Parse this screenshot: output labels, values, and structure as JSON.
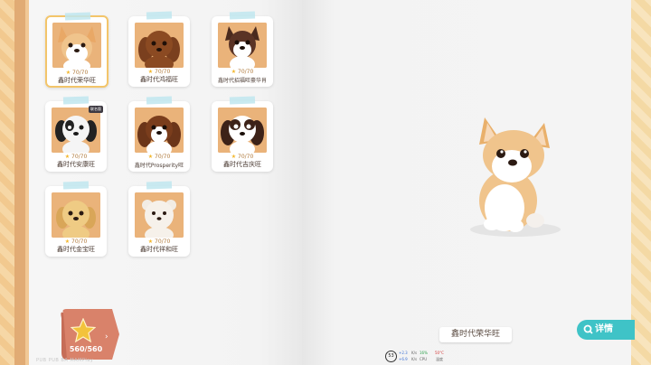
{
  "cards": [
    {
      "stars": "70/70",
      "name": "鑫时代荣华旺",
      "selected": true
    },
    {
      "stars": "70/70",
      "name": "鑫时代鸿福旺"
    },
    {
      "stars": "70/70",
      "name": "鑫时代招福旺豪华肖"
    },
    {
      "stars": "70/70",
      "name": "鑫时代安康旺",
      "badge": "联名版"
    },
    {
      "stars": "70/70",
      "name": "鑫时代Prosperity旺"
    },
    {
      "stars": "70/70",
      "name": "鑫时代吉庆旺"
    },
    {
      "stars": "70/70",
      "name": "鑫时代金宝旺"
    },
    {
      "stars": "70/70",
      "name": "鑫时代祥和旺"
    }
  ],
  "star_total": "560/560",
  "selected_name": "鑫时代荣华旺",
  "details_label": "详情",
  "faint_text": "PUB  PUB  BA MAMPlay",
  "perf": {
    "fps": "53",
    "up": "+2.3",
    "down": "+6.9",
    "unit_up": "K/s",
    "unit_down": "K/s",
    "cpu_val": "16%",
    "cpu_label": "CPU",
    "temp_val": "50°C",
    "temp_label": "温度"
  },
  "colors": {
    "accent": "#3fc3c7",
    "ribbon": "#d9826a",
    "star": "#f3c33b"
  }
}
